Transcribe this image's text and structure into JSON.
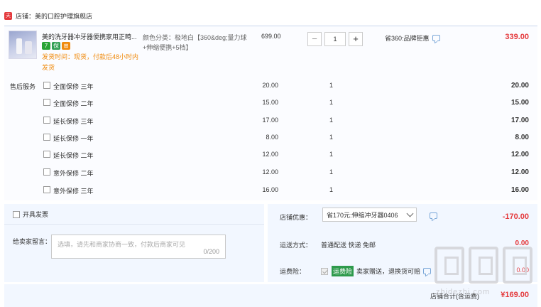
{
  "store": {
    "badge": "天猫",
    "name": "店铺：美的口腔护理旗舰店"
  },
  "product": {
    "title": "美的洗牙器冲牙器便携家用正畸...",
    "badges": [
      "7",
      "保",
      "⊞"
    ],
    "shipping": "发货时间：现货，付款后48小时内发货",
    "attr": "颜色分类：极地白【360&deg;量力球+伸缩便携+5档】",
    "price": "699.00",
    "qty": "1",
    "qty_minus": "−",
    "qty_plus": "+",
    "save": "省360:品牌钜惠",
    "subtotal": "339.00"
  },
  "services": {
    "label": "售后服务",
    "items": [
      {
        "name": "全面保修 三年",
        "price": "20.00",
        "qty": "1",
        "total": "20.00"
      },
      {
        "name": "全面保修 二年",
        "price": "15.00",
        "qty": "1",
        "total": "15.00"
      },
      {
        "name": "延长保修 三年",
        "price": "17.00",
        "qty": "1",
        "total": "17.00"
      },
      {
        "name": "延长保修 一年",
        "price": "8.00",
        "qty": "1",
        "total": "8.00"
      },
      {
        "name": "延长保修 二年",
        "price": "12.00",
        "qty": "1",
        "total": "12.00"
      },
      {
        "name": "意外保修 二年",
        "price": "12.00",
        "qty": "1",
        "total": "12.00"
      },
      {
        "name": "意外保修 三年",
        "price": "16.00",
        "qty": "1",
        "total": "16.00"
      }
    ]
  },
  "invoice": {
    "label": "开具发票"
  },
  "message": {
    "label": "给卖家留言：",
    "placeholder": "选填，请先和商家协商一致，付款后商家可见",
    "count": "0/200"
  },
  "coupon": {
    "label": "店铺优惠：",
    "value": "省170元:伸缩冲牙器0406",
    "discount": "-170.00"
  },
  "shipping": {
    "label": "运送方式：",
    "method": "普通配送 快递 免邮",
    "fee": "0.00"
  },
  "insurance": {
    "label": "运费险：",
    "badge": "运费险",
    "text": "卖家赠送，退换货可赔",
    "fee": "0.00"
  },
  "total": {
    "label": "店铺合计(含运费)",
    "value": "¥169.00"
  },
  "watermark": {
    "text": "zhidezhi.com"
  }
}
